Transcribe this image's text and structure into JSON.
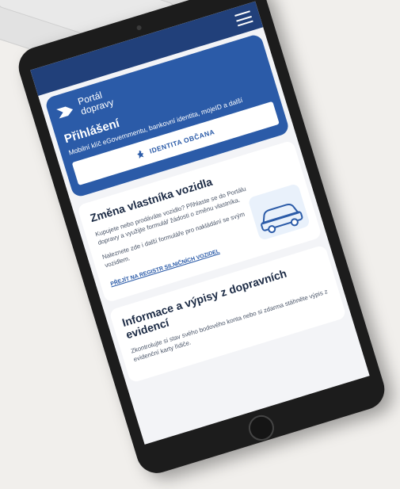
{
  "portal": {
    "brand_line1": "Portál",
    "brand_line2": "dopravy"
  },
  "login": {
    "title": "Přihlášení",
    "subtitle": "Mobilní klíč eGovernmentu, bankovní identita, mojeID a další",
    "button_label": "IDENTITA OBČANA"
  },
  "card_vehicle": {
    "title": "Změna vlastníka vozidla",
    "paragraph1": "Kupujete nebo prodáváte vozidlo? Přihlaste se do Portálu dopravy a využijte formulář žádosti o změnu vlastníka.",
    "paragraph2": "Naleznete zde i další formuláře pro nakládání se svým vozidlem.",
    "link_label": "PŘEJÍT NA REGISTR SILNIČNÍCH VOZIDEL"
  },
  "card_records": {
    "title": "Informace a výpisy z dopravních evidencí",
    "paragraph1": "Zkontrolujte si stav svého bodového konta nebo si zdarma stáhněte výpis z evidenční karty řidiče."
  },
  "colors": {
    "topbar": "#21407a",
    "hero": "#2b5ba8",
    "background": "#f3f4f7"
  }
}
